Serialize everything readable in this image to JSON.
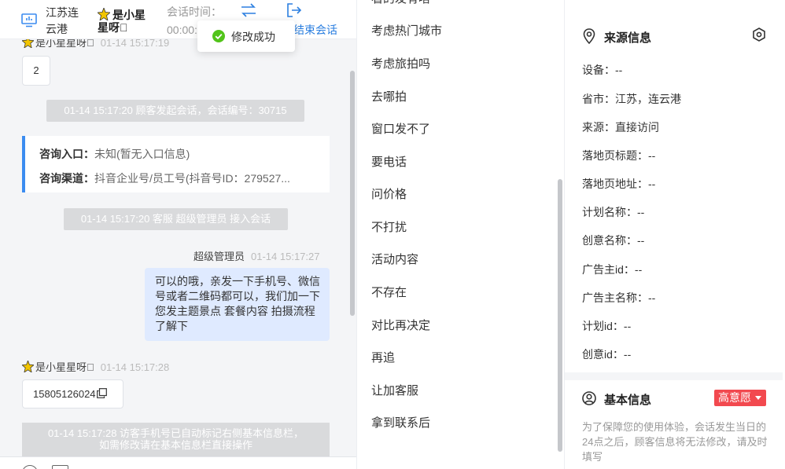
{
  "header": {
    "location": "江苏连云港",
    "customer_name": "是小星星呀􀀀",
    "session_time_label": "会话时间：",
    "session_time_value": "00:00:",
    "end_session_label": "结束会话"
  },
  "toast": {
    "text": "修改成功"
  },
  "chat": {
    "top_meta_name": "是小星星呀􀀀",
    "top_meta_time": "01-14 15:17:19",
    "msg_number": "2",
    "sys_1": "01-14 15:17:20 顾客发起会话，会话编号：30715",
    "entry_label": "咨询入口：",
    "entry_value": "未知(暂无入口信息)",
    "channel_label": "咨询渠道：",
    "channel_value": "抖音企业号/员工号(抖音号ID：279527...",
    "sys_2": "01-14 15:17:20 客服 超级管理员 接入会话",
    "agent_name": "超级管理员",
    "agent_time": "01-14 15:17:27",
    "agent_msg": "可以的哦，亲发一下手机号、微信号或者二维码都可以，我们加一下您发主题景点 套餐内容 拍摄流程了解下",
    "cust_name": "是小星星呀􀀀",
    "cust_time": "01-14 15:17:28",
    "phone": "15805126024",
    "sys_3_line1": "01-14 15:17:28 访客手机号已自动标记右侧基本信息栏，",
    "sys_3_line2": "如需修改请在基本信息栏直接操作"
  },
  "quick_replies": {
    "items": [
      "看的发有啥",
      "考虑热门城市",
      "考虑旅拍吗",
      "去哪拍",
      "窗口发不了",
      "要电话",
      "问价格",
      "不打扰",
      "活动内容",
      "不存在",
      "对比再决定",
      "再追",
      "让加客服",
      "拿到联系后"
    ]
  },
  "source_info": {
    "title": "来源信息",
    "rows": [
      {
        "label": "设备：",
        "value": "--"
      },
      {
        "label": "省市：",
        "value": "江苏，连云港"
      },
      {
        "label": "来源：",
        "value": "直接访问"
      },
      {
        "label": "落地页标题：",
        "value": "--"
      },
      {
        "label": "落地页地址：",
        "value": "--"
      },
      {
        "label": "计划名称：",
        "value": "--"
      },
      {
        "label": "创意名称：",
        "value": "--"
      },
      {
        "label": "广告主id：",
        "value": "--"
      },
      {
        "label": "广告主名称：",
        "value": "--"
      },
      {
        "label": "计划id：",
        "value": "--"
      },
      {
        "label": "创意id：",
        "value": "--"
      }
    ]
  },
  "basic_info": {
    "title": "基本信息",
    "intent_label": "高意愿",
    "note": "为了保障您的使用体验，会话发生当日的24点之后，顾客信息将无法修改，请及时填写"
  },
  "colors": {
    "accent_blue": "#2b7fe0",
    "card_border": "#3b8cf0",
    "agent_bubble": "#dfeaff",
    "intent_red": "#f2494f",
    "success_green": "#52c41a"
  }
}
